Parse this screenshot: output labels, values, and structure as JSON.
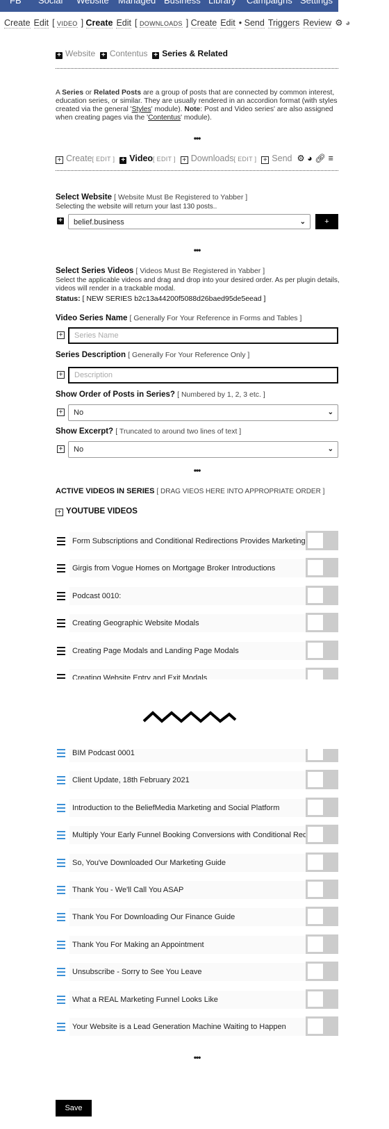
{
  "top_nav": [
    "FB",
    "Social",
    "Website",
    "Managed",
    "Business",
    "Library",
    "Campaigns",
    "Settings"
  ],
  "sub_nav": {
    "create1": "Create",
    "edit1": "Edit",
    "video": "VIDEO",
    "create2": "Create",
    "edit2": "Edit",
    "downloads": "DOWNLOADS",
    "create3": "Create",
    "edit3": "Edit",
    "sep": "•",
    "send": "Send",
    "triggers": "Triggers",
    "review": "Review",
    "open_bracket": "[",
    "close_bracket": "]"
  },
  "section_tabs": [
    "Website",
    "Contentus",
    "Series & Related"
  ],
  "intro": {
    "p1": "A ",
    "series": "Series",
    "p2": " or ",
    "related": "Related Posts",
    "p3": " are a group of posts that are connected by common interest, education series, or similar. They are usually rendered in an accordion format (with styles created via the general '",
    "styles": "Styles",
    "p4": "' module). ",
    "note": "Note",
    "p5": ": Post and Video series' are also assigned when creating pages via the '",
    "contentus": "Contentus",
    "p6": "' module)."
  },
  "dots": "•••",
  "module_tabs": {
    "create": "Create",
    "video": "Video",
    "downloads": "Downloads",
    "send": "Send",
    "edit": "[ EDIT ]"
  },
  "select_website": {
    "label": "Select Website",
    "hint": "[ Website Must Be Registered to Yabber ]",
    "desc": "Selecting the website will return your last 130 posts..",
    "value": "belief.business",
    "add": "+"
  },
  "series_videos": {
    "label": "Select Series Videos",
    "hint": "[ Videos Must Be Registered in Yabber ]",
    "desc": "Select the applicable videos and drag and drop into your desired order. As per plugin details, videos will render in a trackable modal.",
    "status_label": "Status:",
    "status_value": "[ NEW SERIES b2c13a44200f5088d26baed95de5eead ]"
  },
  "series_name": {
    "label": "Video Series Name",
    "hint": "[ Generally For Your Reference in Forms and Tables ]",
    "placeholder": "Series Name"
  },
  "series_desc": {
    "label": "Series Description",
    "hint": "[ Generally For Your Reference Only ]",
    "placeholder": "Description"
  },
  "show_order": {
    "label": "Show Order of Posts in Series?",
    "hint": "[ Numbered by 1, 2, 3 etc. ]",
    "value": "No"
  },
  "show_excerpt": {
    "label": "Show Excerpt?",
    "hint": "[ Truncated to around two lines of text ]",
    "value": "No"
  },
  "active": {
    "label": "ACTIVE VIDEOS IN SERIES",
    "hint": "[ DRAG VIEOS HERE INTO APPROPRIATE ORDER ]",
    "group": "YOUTUBE VIDEOS"
  },
  "videos_top": [
    "Form Subscriptions and Conditional Redirections Provides Marketing",
    "Girgis from Vogue Homes on Mortgage Broker Introductions",
    "Podcast 0010:",
    "Creating Geographic Website Modals",
    "Creating Page Modals and Landing Page Modals",
    "Creating Website Entry and Exit Modals"
  ],
  "videos_bottom": [
    "BIM Podcast 0001",
    "Client Update, 18th February 2021",
    "Introduction to the BeliefMedia Marketing and Social Platform",
    "Multiply Your Early Funnel Booking Conversions with Conditional Redirections",
    "So, You've Downloaded Our Marketing Guide",
    "Thank You - We'll Call You ASAP",
    "Thank You For Downloading Our Finance Guide",
    "Thank You For Making an Appointment",
    "Unsubscribe - Sorry to See You Leave",
    "What a REAL Marketing Funnel Looks Like",
    "Your Website is a Lead Generation Machine Waiting to Happen"
  ],
  "save": "Save",
  "colors": {
    "nav": "#3b5998",
    "list_handle_bottom": "#3a8fd6",
    "toggle_off": "#cccccc"
  }
}
